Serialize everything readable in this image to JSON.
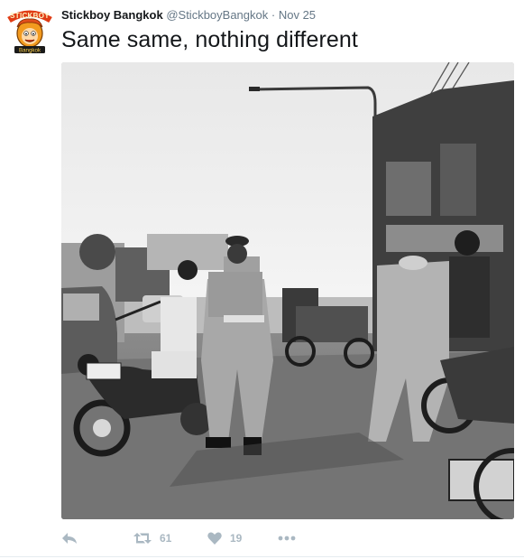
{
  "tweet": {
    "author_name": "Stickboy Bangkok",
    "author_handle": "@StickboyBangkok",
    "separator": "·",
    "date": "Nov 25",
    "text": "Same same, nothing different",
    "avatar_icon": "cartoon-face-logo",
    "avatar_word_top": "STICKBOY",
    "avatar_word_bottom": "Bangkok"
  },
  "actions": {
    "reply_icon": "reply-icon",
    "retweet_icon": "retweet-icon",
    "retweet_count": "61",
    "like_icon": "heart-icon",
    "like_count": "19",
    "more_icon": "more-dots-icon"
  },
  "colors": {
    "text_primary": "#14171a",
    "text_secondary": "#657786",
    "action_gray": "#aab8c2",
    "divider": "#e6ecf0",
    "avatar_orange": "#f29a1f"
  }
}
